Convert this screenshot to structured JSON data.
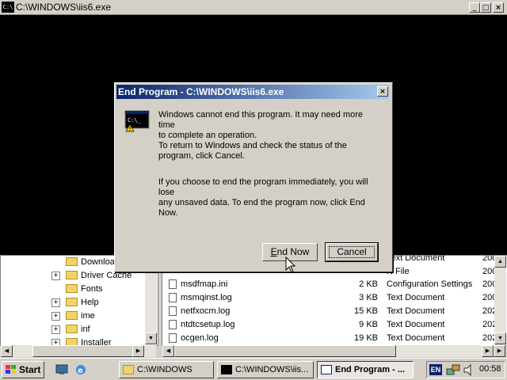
{
  "console": {
    "title": "C:\\WINDOWS\\iis6.exe",
    "icon_label": "C:\\",
    "controls": {
      "minimize": "_",
      "maximize": "□",
      "close": "×"
    }
  },
  "dialog": {
    "title": "End Program - C:\\WINDOWS\\iis6.exe",
    "close_glyph": "×",
    "icon": "console-warning-icon",
    "message1_line1": "Windows cannot end this program. It may need more time",
    "message1_line2": "to complete an operation.",
    "message2_line1": "To return to Windows and check the status of the",
    "message2_line2": "program, click Cancel.",
    "message3_line1": "If you choose to end the program immediately, you will lose",
    "message3_line2": "any unsaved data. To end the program now, click End",
    "message3_line3": "Now.",
    "end_now_label_u": "E",
    "end_now_label_rest": "nd Now",
    "cancel_label": "Cancel"
  },
  "tree": {
    "items": [
      {
        "label": "Downloa",
        "expander": ""
      },
      {
        "label": "Driver Cache",
        "expander": "+"
      },
      {
        "label": "Fonts",
        "expander": ""
      },
      {
        "label": "Help",
        "expander": "+"
      },
      {
        "label": "ime",
        "expander": "+"
      },
      {
        "label": "inf",
        "expander": "+"
      },
      {
        "label": "Installer",
        "expander": "+"
      }
    ]
  },
  "file_list": {
    "rows": [
      {
        "name": "",
        "size": "",
        "type": "Text Document",
        "date": "200"
      },
      {
        "name": "",
        "size": "",
        "type": "N File",
        "date": "200"
      },
      {
        "name": "msdfmap.ini",
        "size": "2 KB",
        "type": "Configuration Settings",
        "date": "200"
      },
      {
        "name": "msmqinst.log",
        "size": "3 KB",
        "type": "Text Document",
        "date": "200"
      },
      {
        "name": "netfxocm.log",
        "size": "15 KB",
        "type": "Text Document",
        "date": "202"
      },
      {
        "name": "ntdtcsetup.log",
        "size": "9 KB",
        "type": "Text Document",
        "date": "202"
      },
      {
        "name": "ocgen.log",
        "size": "19 KB",
        "type": "Text Document",
        "date": "202"
      }
    ]
  },
  "scroll": {
    "up": "▲",
    "down": "▼",
    "left": "◀",
    "right": "▶"
  },
  "taskbar": {
    "start_label": "Start",
    "tasks": [
      {
        "label": "C:\\WINDOWS",
        "icon": "folder-icon"
      },
      {
        "label": "C:\\WINDOWS\\iis...",
        "icon": "console-icon"
      },
      {
        "label": "End Program - ...",
        "icon": "window-icon"
      }
    ],
    "language": "EN",
    "clock": "00:58"
  },
  "colors": {
    "title_active": "#0a246a",
    "title_gradient_end": "#a6caf0",
    "face": "#d4d0c8",
    "console_bg": "#000000"
  }
}
